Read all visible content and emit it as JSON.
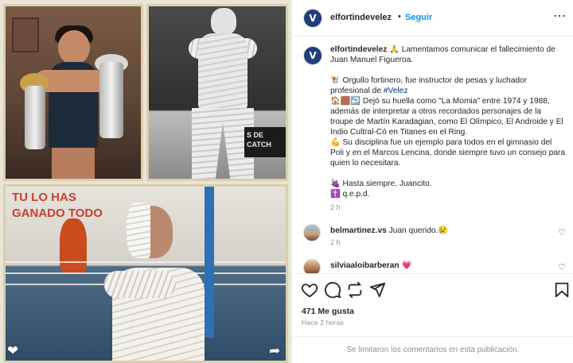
{
  "header": {
    "username": "elfortindevelez",
    "separator": "•",
    "follow_label": "Seguir",
    "more_icon": "more-horizontal-icon"
  },
  "media": {
    "photo1_alt": "",
    "photo2_banner": "S DE\nCATCH",
    "photo3_wall_text": "TU LO HAS\nGANADO TODO",
    "like_icon": "heart-filled-icon",
    "share_icon": "share-arrow-icon"
  },
  "caption": {
    "username": "elfortindevelez",
    "lines": [
      "🙏 Lamentamos comunicar el fallecimiento de Juan Manuel Figueroa.",
      "",
      "🐮 Orgullo fortinero, fue instructor de pesas y luchador profesional de ",
      "🏠🟫↩️ Dejó su huella como \"La Momia\" entre 1974 y 1988, además de interpretar a otros recordados personajes de la troupe de Martín Karadagian, como El Olímpico, El Androide y El Indio Cultral-Có en Titanes en el Ring.",
      "💪 Su disciplina fue un ejemplo para todos en el gimnasio del Poli y en el Marcos Lencina, donde siempre tuvo un consejo para quien lo necesitara.",
      "",
      "🍇 Hasta siempre, Juancito.",
      "✝️ q.e.p.d."
    ],
    "hashtag": "#Velez",
    "time": "2 h"
  },
  "comments": [
    {
      "username": "belmartinez.vs",
      "text": "Juan querido.😢",
      "time": "2 h"
    },
    {
      "username": "silviaaloibarberan",
      "text": "💗",
      "time": ""
    }
  ],
  "actions": {
    "likes_label": "471 Me gusta",
    "ago_label": "Hace 2 horas",
    "comments_limited": "Se limitaron los comentarios en esta publicación."
  },
  "colors": {
    "accent": "#0095f6",
    "text": "#262626",
    "muted": "#8e8e8e",
    "hashtag": "#00376b"
  }
}
